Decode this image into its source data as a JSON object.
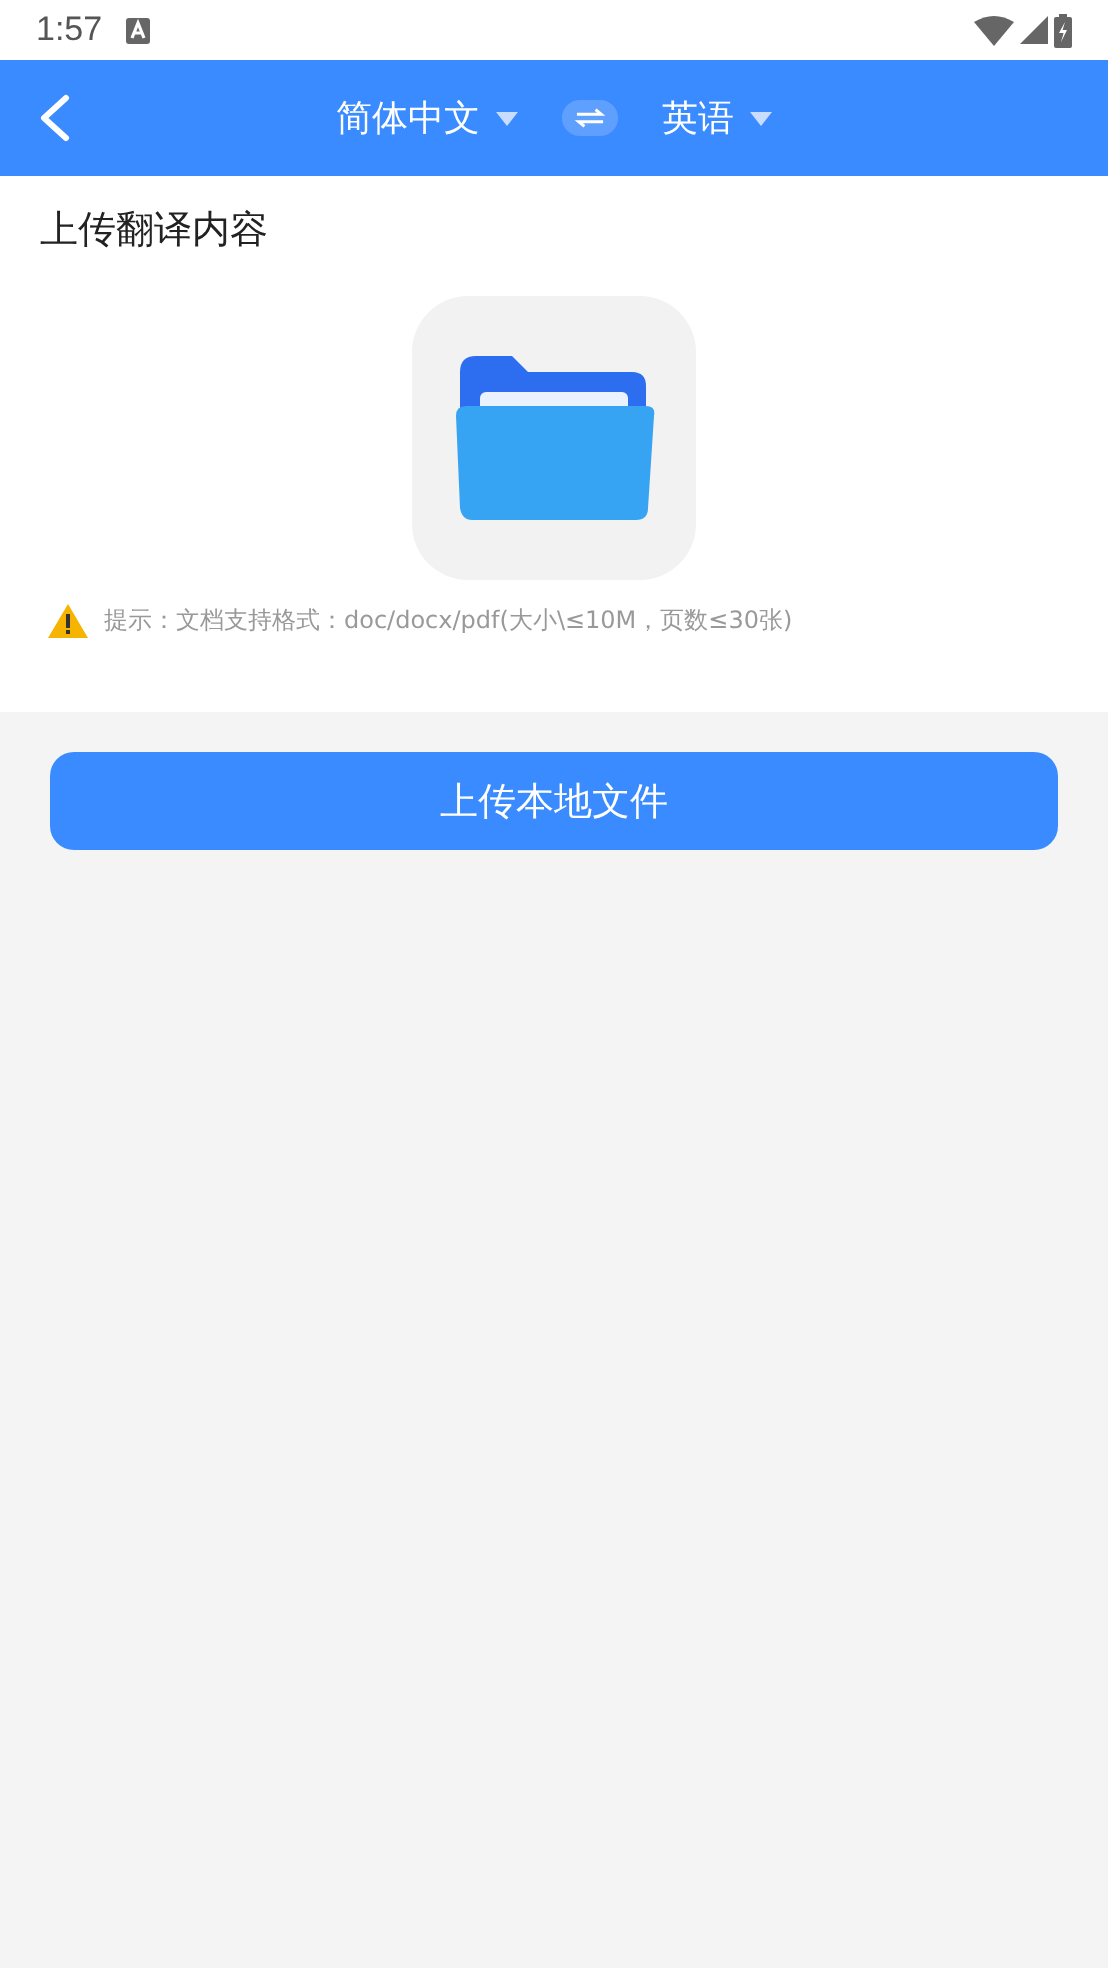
{
  "status_bar": {
    "time": "1:57"
  },
  "header": {
    "source_language": "简体中文",
    "target_language": "英语"
  },
  "upload_section": {
    "title": "上传翻译内容",
    "hint": "提示：文档支持格式：doc/docx/pdf(大小\\≤10M，页数≤30张)"
  },
  "upload_button": {
    "label": "上传本地文件"
  }
}
